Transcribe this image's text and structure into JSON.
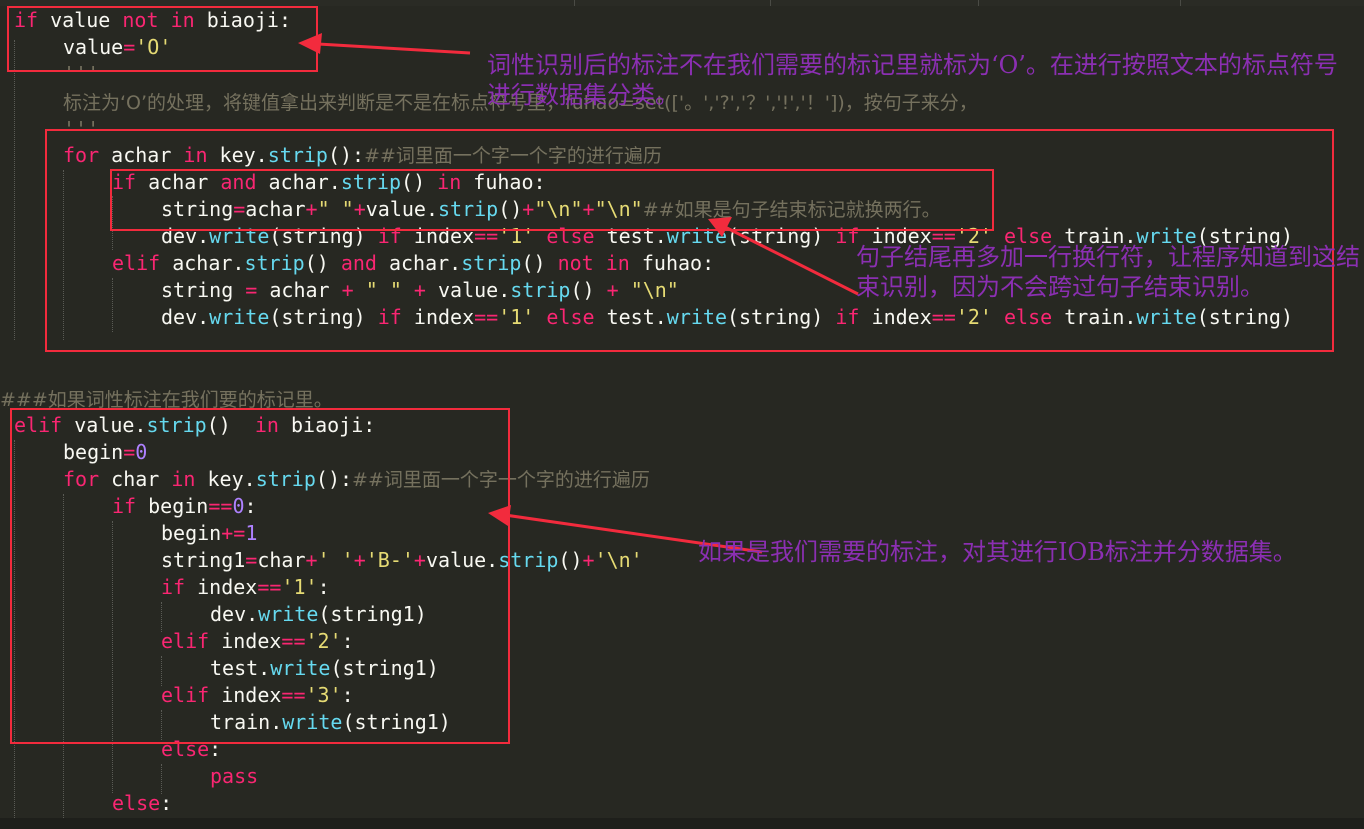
{
  "editor": {
    "lines": [
      {
        "text": "if value not in biaoji:"
      },
      {
        "text": "value='O'"
      },
      {
        "text": "'''"
      },
      {
        "text": "标注为‘O’的处理，将键值拿出来判断是不是在标点符号里，fuhao=set(['。','?','？','!','！'])，按句子来分，"
      },
      {
        "text": "'''"
      },
      {
        "text": "for achar in key.strip():##词里面一个字一个字的进行遍历"
      },
      {
        "text": "if achar and achar.strip() in fuhao:"
      },
      {
        "text": "string=achar+\" \"+value.strip()+\"\\n\"+\"\\n\"##如果是句子结束标记就换两行。"
      },
      {
        "text": "dev.write(string) if index=='1' else test.write(string) if index=='2' else train.write(string)"
      },
      {
        "text": "elif achar.strip() and achar.strip() not in fuhao:"
      },
      {
        "text": "string = achar + \" \" + value.strip() + \"\\n\""
      },
      {
        "text": "dev.write(string) if index=='1' else test.write(string) if index=='2' else train.write(string)"
      },
      {
        "text": "###如果词性标注在我们要的标记里。"
      },
      {
        "text": "elif value.strip()  in biaoji:"
      },
      {
        "text": "begin=0"
      },
      {
        "text": "for char in key.strip():##词里面一个字一个字的进行遍历"
      },
      {
        "text": "if begin==0:"
      },
      {
        "text": "begin+=1"
      },
      {
        "text": "string1=char+' '+'B-'+value.strip()+'\\n'"
      },
      {
        "text": "if index=='1':"
      },
      {
        "text": "dev.write(string1)"
      },
      {
        "text": "elif index=='2':"
      },
      {
        "text": "test.write(string1)"
      },
      {
        "text": "elif index=='3':"
      },
      {
        "text": "train.write(string1)"
      },
      {
        "text": "else:"
      },
      {
        "text": "pass"
      },
      {
        "text": "else:"
      }
    ]
  },
  "annotations": [
    {
      "text": "词性识别后的标注不在我们需要的标记里就标为‘O’。在进行按照文本的标点符号进行数据集分类。"
    },
    {
      "text": "句子结尾再多加一行换行符，让程序知道到这结束识别，因为不会跨过句子结束识别。"
    },
    {
      "text": "如果是我们需要的标注，对其进行IOB标注并分数据集。"
    }
  ],
  "colors": {
    "background": "#272822",
    "keyword": "#f92672",
    "function": "#66d9ef",
    "string": "#e6db74",
    "number": "#ae81ff",
    "comment": "#75715e",
    "box": "#f22b3d",
    "annotation": "#8b2fb2"
  }
}
